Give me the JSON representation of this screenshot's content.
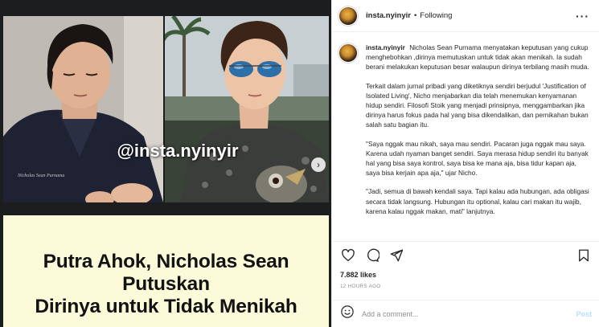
{
  "post": {
    "watermark": "@insta.nyinyir",
    "caption_lines": [
      "Putra Ahok, Nicholas Sean Putuskan",
      "Dirinya untuk Tidak Menikah"
    ],
    "shirt_text": "Nicholas Sean Purnama"
  },
  "header": {
    "username": "insta.nyinyir",
    "separator": "•",
    "follow_status": "Following",
    "more_icon": "more-horizontal-icon"
  },
  "caption": {
    "username": "insta.nyinyir",
    "paragraphs": [
      "Nicholas Sean Purnama menyatakan keputusan yang cukup menghebohkan ,dirinya memutuskan untuk tidak akan menikah. Ia sudah berani melakukan keputusan besar walaupun dirinya terbilang masih muda.",
      "Terkait dalam jurnal pribadi yang diketiknya sendiri berjudul 'Justification of Isolated Living', Nicho menjabarkan dia telah menemukan kenyamanan hidup sendiri. Filosofi Stoik yang menjadi prinsipnya, menggambarkan jika dirinya harus fokus pada hal yang bisa dikendalikan, dan pernikahan bukan salah satu bagian itu.",
      "\"Saya nggak mau nikah, saya mau sendiri. Pacaran juga nggak mau saya. Karena udah nyaman banget sendiri. Saya merasa hidup sendiri itu banyak hal yang bisa saya kontrol, saya bisa ke mana aja, bisa tidur kapan aja, saya bisa kerjain apa aja,\" ujar Nicho.",
      "\"Jadi, semua di bawah kendali saya. Tapi kalau ada hubungan, ada obligasi secara tidak langsung. Hubungan itu optional, kalau cari makan itu wajib, karena kalau nggak makan, mati\" lanjutnya."
    ]
  },
  "actions": {
    "like_icon": "heart-icon",
    "comment_icon": "comment-bubble-icon",
    "share_icon": "paper-plane-icon",
    "save_icon": "bookmark-icon"
  },
  "stats": {
    "likes": "7.882 likes",
    "time_ago": "12 HOURS AGO"
  },
  "comment_box": {
    "emoji_icon": "smiley-icon",
    "placeholder": "Add a comment...",
    "post_label": "Post"
  }
}
